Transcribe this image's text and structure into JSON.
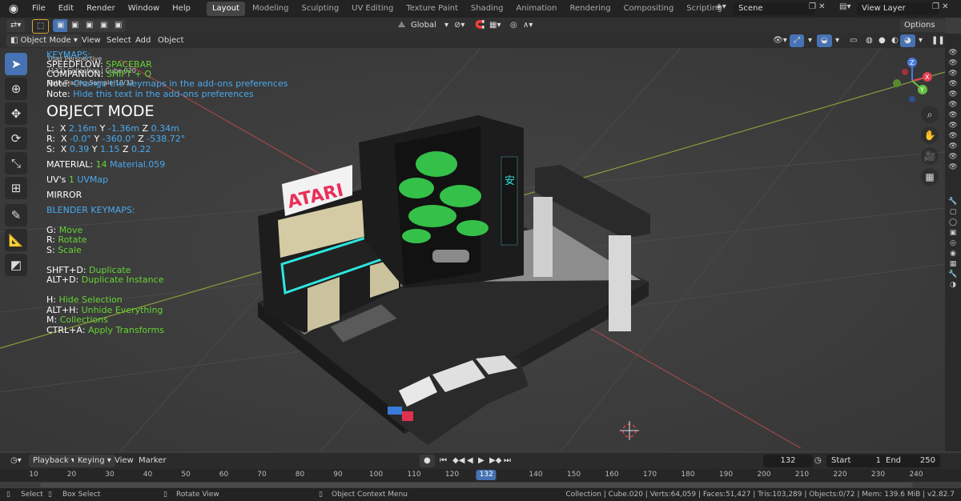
{
  "topbar": {
    "menus": [
      "File",
      "Edit",
      "Render",
      "Window",
      "Help"
    ],
    "workspaces": [
      "Layout",
      "Modeling",
      "Sculpting",
      "UV Editing",
      "Texture Paint",
      "Shading",
      "Animation",
      "Rendering",
      "Compositing",
      "Scripting"
    ],
    "active_workspace": "Layout",
    "scene": "Scene",
    "view_layer": "View Layer"
  },
  "header": {
    "orientation": "Global",
    "options": "Options"
  },
  "viewport_header": {
    "mode": "Object Mode",
    "view": "View",
    "select": "Select",
    "add": "Add",
    "object": "Object"
  },
  "overlay": {
    "perspective": "User Perspective",
    "collection_line": "(132) Collection | Cube.020",
    "render_line": "Path Tracing Sample 10/32",
    "keymaps_header": "KEYMAPS:",
    "speedflow_key": "SPEEDFLOW:",
    "speedflow_val": "SPACEBAR",
    "companion_key": "COMPANION:",
    "companion_val": "SHIFT + Q",
    "note1_key": "Note:",
    "note1_val": "Change the keymaps in the add-ons preferences",
    "note2_key": "Note:",
    "note2_val": "Hide this text in the add-ons preferences",
    "mode_title": "OBJECT MODE",
    "loc_label": "L:",
    "loc_x_label": "X",
    "loc_x": "2.16m",
    "loc_y_label": "Y",
    "loc_y": "-1.36m",
    "loc_z_label": "Z",
    "loc_z": "0.34m",
    "rot_label": "R:",
    "rot_x_label": "X",
    "rot_x": "-0.0°",
    "rot_y_label": "Y",
    "rot_y": "-360.0°",
    "rot_z_label": "Z",
    "rot_z": "-538.72°",
    "scale_label": "S:",
    "scale_x_label": "X",
    "scale_x": "0.39",
    "scale_y_label": "Y",
    "scale_y": "1.15",
    "scale_z_label": "Z",
    "scale_z": "0.22",
    "material_label": "MATERIAL:",
    "material_count": "14",
    "material_name": "Material.059",
    "uv_label": "UV's",
    "uv_count": "1",
    "uv_name": "UVMap",
    "mirror": "MIRROR",
    "blender_keymaps": "BLENDER KEYMAPS:",
    "g_key": "G:",
    "g_val": "Move",
    "r_key": "R:",
    "r_val": "Rotate",
    "s_key": "S:",
    "s_val": "Scale",
    "dup_key": "SHFT+D:",
    "dup_val": "Duplicate",
    "dupi_key": "ALT+D:",
    "dupi_val": "Duplicate Instance",
    "h_key": "H:",
    "h_val": "Hide Selection",
    "ah_key": "ALT+H:",
    "ah_val": "Unhide Everything",
    "m_key": "M:",
    "m_val": "Collections",
    "ca_key": "CTRL+A:",
    "ca_val": "Apply Transforms"
  },
  "gizmo": {
    "x": "X",
    "y": "Y",
    "z": "Z"
  },
  "scene_objects": {
    "sign": "ATARI"
  },
  "timeline": {
    "playback": "Playback",
    "keying": "Keying",
    "view": "View",
    "marker": "Marker",
    "current_frame": "132",
    "start_label": "Start",
    "start": "1",
    "end_label": "End",
    "end": "250",
    "ticks": [
      "10",
      "20",
      "30",
      "40",
      "50",
      "60",
      "70",
      "80",
      "90",
      "100",
      "110",
      "120",
      "132",
      "140",
      "150",
      "160",
      "170",
      "180",
      "190",
      "200",
      "210",
      "220",
      "230",
      "240"
    ]
  },
  "status": {
    "select": "Select",
    "box_select": "Box Select",
    "rotate_view": "Rotate View",
    "context_menu": "Object Context Menu",
    "stats": "Collection | Cube.020 | Verts:64,059 | Faces:51,427 | Tris:103,289 | Objects:0/72 | Mem: 139.6 MiB | v2.82.7"
  },
  "colors": {
    "accent": "#4772b3",
    "green": "#66d433",
    "blue": "#4aa9ef",
    "sign_pink": "#e8305a",
    "neon": "#2ee6e0"
  }
}
